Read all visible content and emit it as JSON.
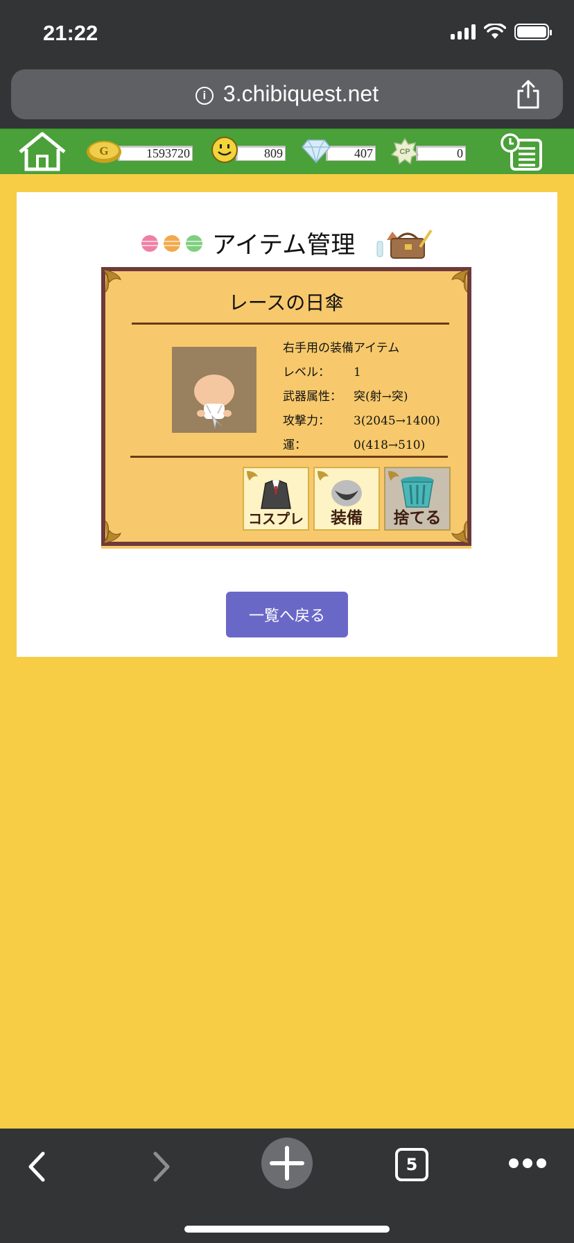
{
  "status_bar": {
    "time": "21:22"
  },
  "browser": {
    "url": "3.chibiquest.net",
    "tab_count": "5"
  },
  "game_bar": {
    "gold": "1593720",
    "smile": "809",
    "diamond": "407",
    "cp_icon_label": "CP",
    "gold_icon_label": "G",
    "cp": "0"
  },
  "page": {
    "title": "アイテム管理"
  },
  "item": {
    "name": "レースの日傘",
    "description": "右手用の装備アイテム",
    "stats": [
      {
        "label": "レベル：",
        "value": "1"
      },
      {
        "label": "武器属性：",
        "value": "突(射→突)"
      },
      {
        "label": "攻撃力：",
        "value": "3(2045→1400)"
      },
      {
        "label": "運：",
        "value": "0(418→510)"
      }
    ],
    "actions": {
      "cosplay": "コスプレ",
      "equip": "装備",
      "discard": "捨てる"
    }
  },
  "back_button": "一覧へ戻る",
  "colors": {
    "game_bar": "#4aa039",
    "background": "#f7cd46",
    "card": "#f7c96c",
    "button": "#6a68c7"
  }
}
